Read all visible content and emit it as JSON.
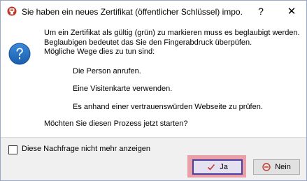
{
  "window": {
    "title": "Sie haben ein neues Zertifikat (öffentlicher Schlüssel) impo...",
    "help_symbol": "?",
    "close_symbol": "✕",
    "accent_color": "#c0392b"
  },
  "message": {
    "lines": [
      "Um ein Zertifikat als gültig (grün) zu markieren muss es beglaubigt werden.",
      "Beglaubigen bedeutet das Sie den Fingerabdruck überpüfen.",
      "Mögliche Wege dies zu tun sind:"
    ],
    "ways": [
      "Die Person anrufen.",
      "Eine Visitenkarte verwenden.",
      "Es anhand einer vertrauenswürden Webseite zu prüfen."
    ],
    "question": "Möchten Sie diesen Prozess jetzt starten?"
  },
  "footer": {
    "checkbox_label": "Diese Nachfrage nicht mehr anzeigen",
    "checkbox_checked": false,
    "yes_label": "Ja",
    "no_label": "Nein"
  },
  "icons": {
    "app": "app-logo-icon",
    "question": "question-icon",
    "yes": "checkmark-icon",
    "no": "no-entry-icon"
  }
}
